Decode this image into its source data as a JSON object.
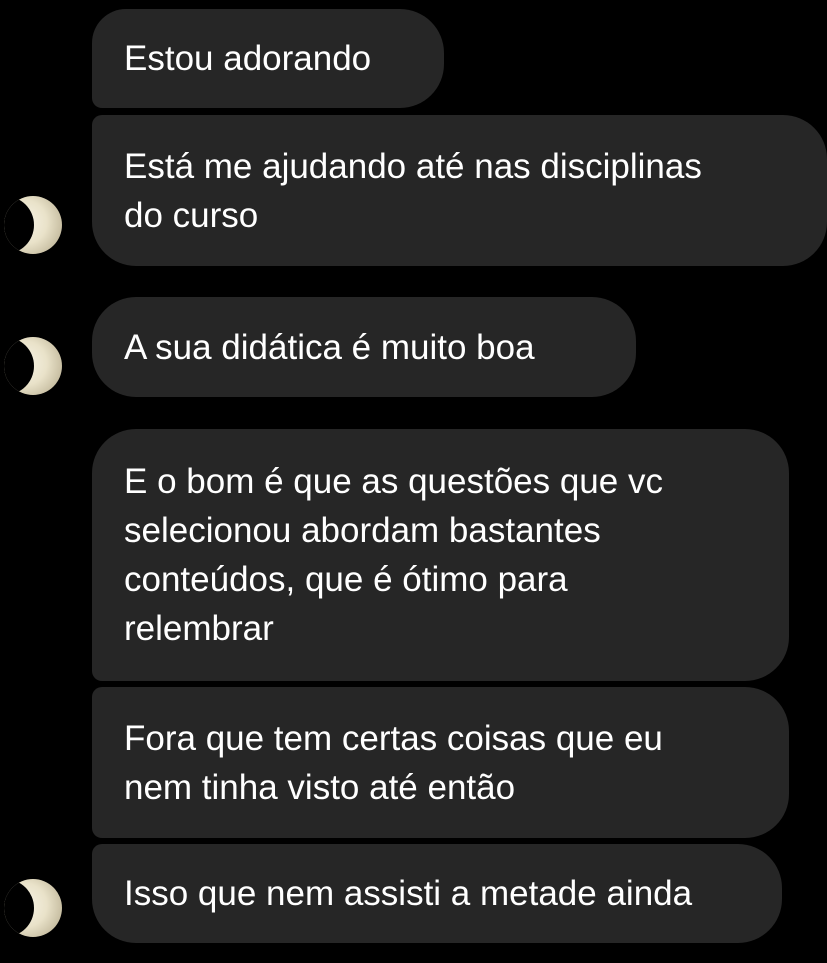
{
  "messages": [
    {
      "text": "Estou adorando"
    },
    {
      "text": "Está me ajudando até nas disciplinas\ndo curso"
    },
    {
      "text": "A sua didática é muito boa"
    },
    {
      "text": "E o bom é que as questões que vc\nselecionou abordam bastantes\nconteúdos, que é ótimo para\nrelembrar"
    },
    {
      "text": "Fora que tem certas coisas que eu\nnem tinha visto até então"
    },
    {
      "text": "Isso que nem assisti a metade ainda"
    }
  ],
  "colors": {
    "background": "#000000",
    "bubble": "#262626",
    "text": "#ffffff"
  }
}
